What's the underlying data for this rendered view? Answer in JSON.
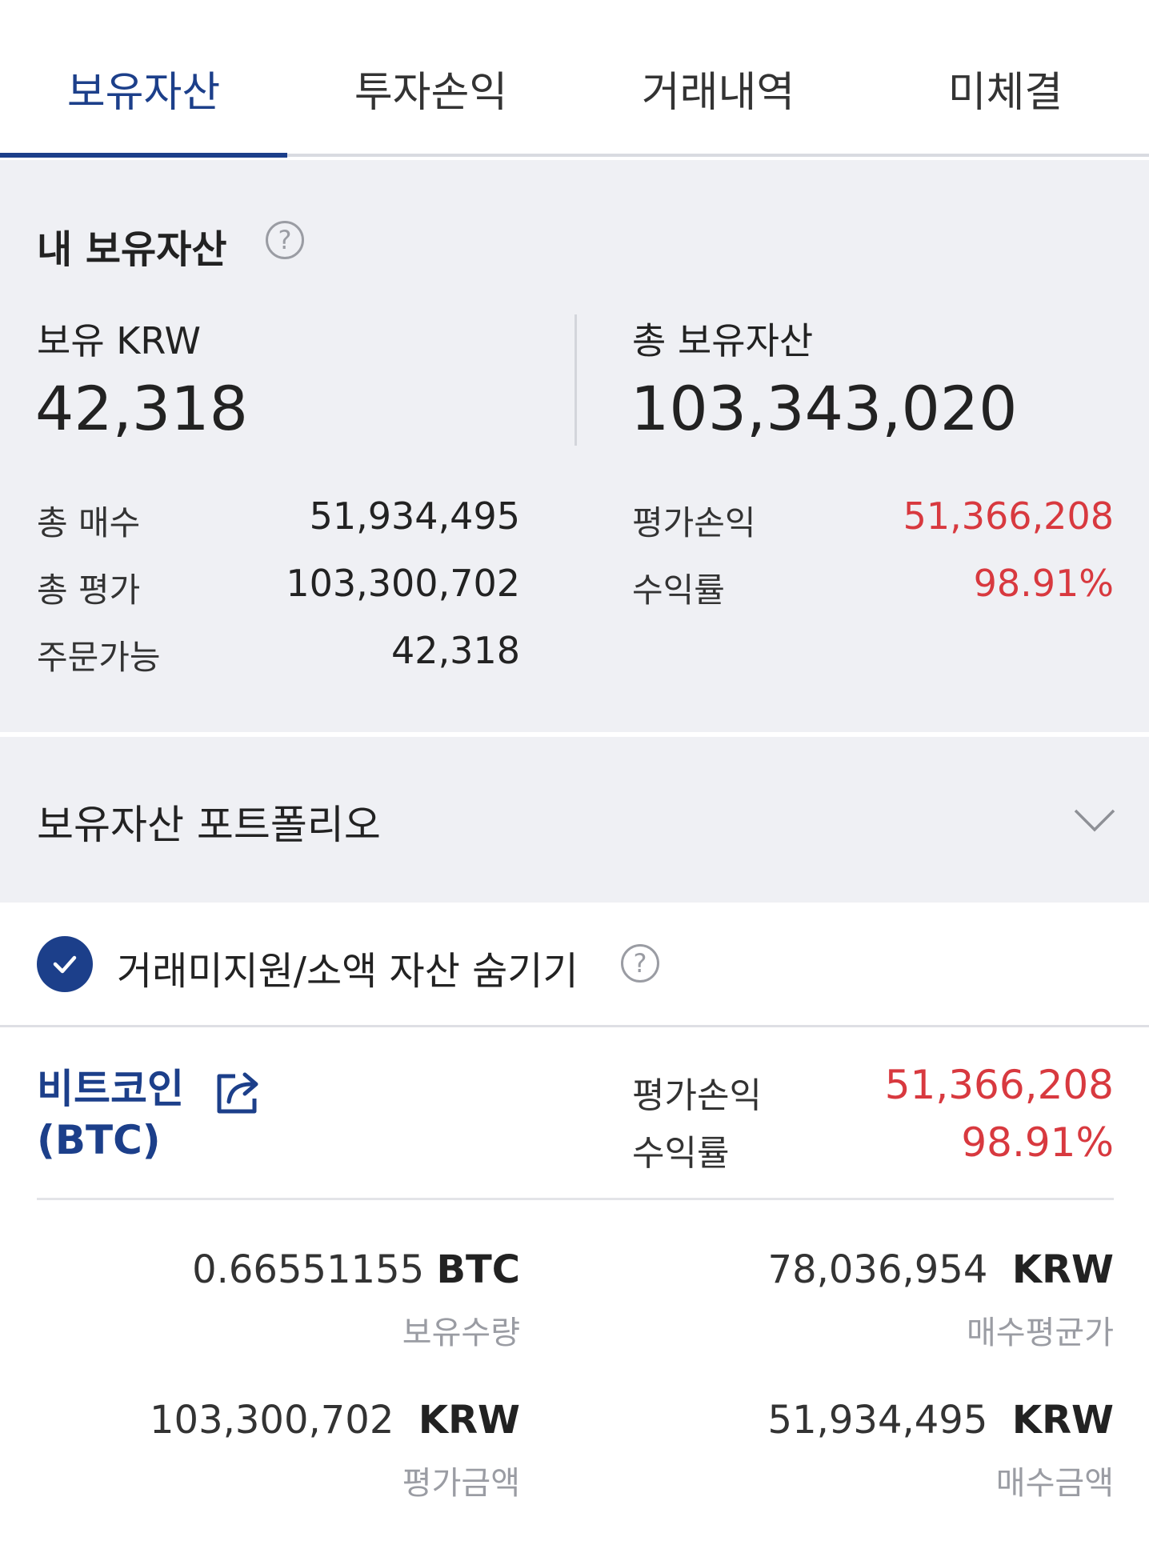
{
  "tabs": [
    {
      "label": "보유자산",
      "active": true
    },
    {
      "label": "투자손익",
      "active": false
    },
    {
      "label": "거래내역",
      "active": false
    },
    {
      "label": "미체결",
      "active": false
    }
  ],
  "summary": {
    "title": "내 보유자산",
    "krw_label": "보유 KRW",
    "krw_value": "42,318",
    "total_label": "총 보유자산",
    "total_value": "103,343,020",
    "left_rows": [
      {
        "label": "총 매수",
        "value": "51,934,495"
      },
      {
        "label": "총 평가",
        "value": "103,300,702"
      },
      {
        "label": "주문가능",
        "value": "42,318"
      }
    ],
    "right_rows": [
      {
        "label": "평가손익",
        "value": "51,366,208"
      },
      {
        "label": "수익률",
        "value": "98.91%"
      }
    ],
    "accent_color": "#1c3f8a",
    "profit_color": "#d8393f"
  },
  "portfolio": {
    "title": "보유자산 포트폴리오"
  },
  "hide_small": {
    "label": "거래미지원/소액 자산 숨기기",
    "checked": true
  },
  "coin": {
    "name": "비트코인",
    "symbol": "(BTC)",
    "pnl_label": "평가손익",
    "pnl_value": "51,366,208",
    "rate_label": "수익률",
    "rate_value": "98.91%",
    "quantity": {
      "value": "0.66551155",
      "unit": "BTC",
      "label": "보유수량"
    },
    "avg_price": {
      "value": "78,036,954",
      "unit": "KRW",
      "label": "매수평균가"
    },
    "eval_amount": {
      "value": "103,300,702",
      "unit": "KRW",
      "label": "평가금액"
    },
    "buy_amount": {
      "value": "51,934,495",
      "unit": "KRW",
      "label": "매수금액"
    }
  },
  "icons": {
    "help": "help-circle-icon",
    "chevron": "chevron-down-icon",
    "check": "check-icon",
    "share": "share-icon"
  }
}
